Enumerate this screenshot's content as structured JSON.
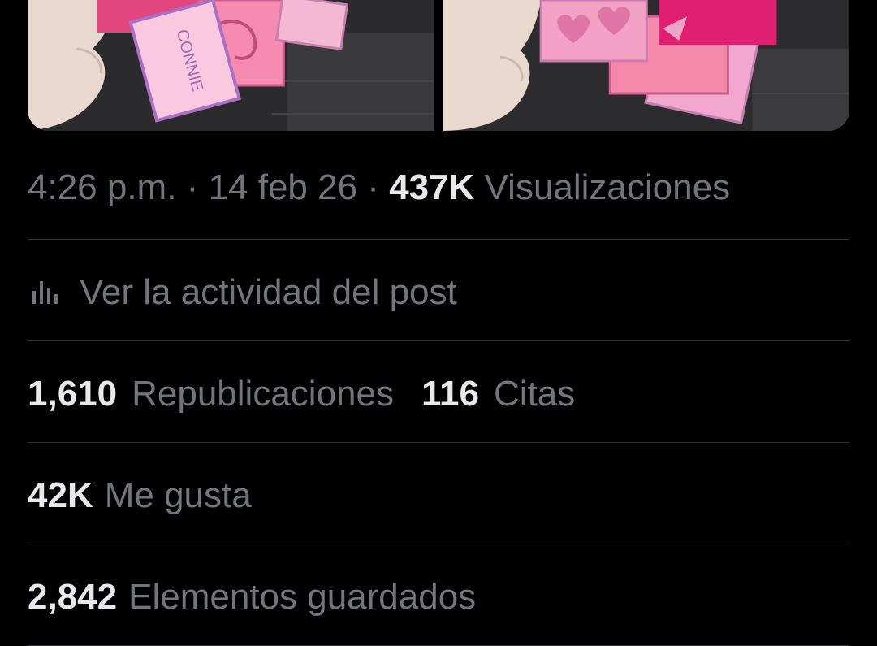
{
  "post": {
    "media": [
      {
        "description": "card-photo",
        "handwritten_name": "CONNIE"
      },
      {
        "description": "card-photo"
      }
    ],
    "time": "4:26 p.m.",
    "separator": "·",
    "date": "14 feb 26",
    "views_count": "437K",
    "views_label": "Visualizaciones"
  },
  "activity": {
    "icon": "analytics-icon",
    "label": "Ver la actividad del post"
  },
  "stats": {
    "reposts_count": "1,610",
    "reposts_label": "Republicaciones",
    "quotes_count": "116",
    "quotes_label": "Citas",
    "likes_count": "42K",
    "likes_label": "Me gusta",
    "bookmarks_count": "2,842",
    "bookmarks_label": "Elementos guardados"
  },
  "colors": {
    "background": "#000000",
    "primary_text": "#e7e9ea",
    "secondary_text": "#71767b",
    "divider": "#2f3336"
  }
}
